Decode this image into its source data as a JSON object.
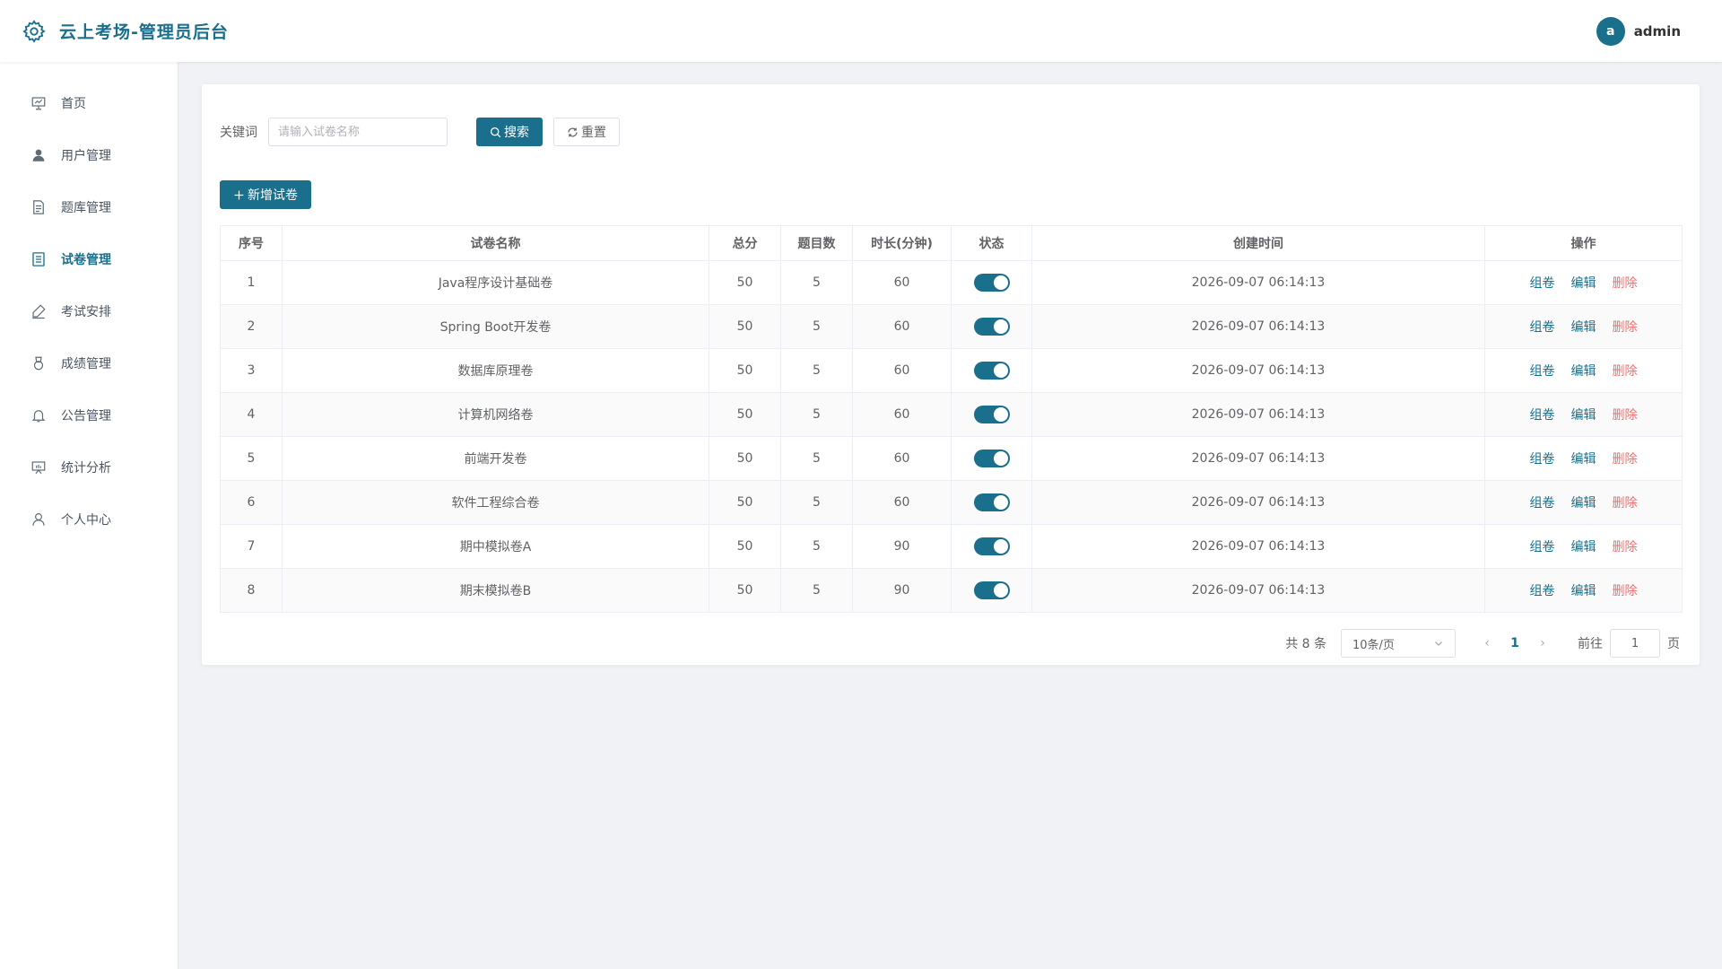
{
  "header": {
    "title": "云上考场-管理员后台",
    "avatar_letter": "a",
    "username": "admin"
  },
  "sidebar": {
    "items": [
      {
        "label": "首页",
        "icon": "presentation-icon"
      },
      {
        "label": "用户管理",
        "icon": "user-icon"
      },
      {
        "label": "题库管理",
        "icon": "document-icon"
      },
      {
        "label": "试卷管理",
        "icon": "tickets-icon",
        "active": true
      },
      {
        "label": "考试安排",
        "icon": "edit-pen-icon"
      },
      {
        "label": "成绩管理",
        "icon": "medal-icon"
      },
      {
        "label": "公告管理",
        "icon": "bell-icon"
      },
      {
        "label": "统计分析",
        "icon": "data-board-icon"
      },
      {
        "label": "个人中心",
        "icon": "user-outline-icon"
      }
    ]
  },
  "search": {
    "label": "关键词",
    "placeholder": "请输入试卷名称",
    "value": "",
    "search_label": "搜索",
    "reset_label": "重置"
  },
  "actions": {
    "add_label": "新增试卷"
  },
  "table": {
    "columns": [
      "序号",
      "试卷名称",
      "总分",
      "题目数",
      "时长(分钟)",
      "状态",
      "创建时间",
      "操作"
    ],
    "op_labels": {
      "compose": "组卷",
      "edit": "编辑",
      "delete": "删除"
    },
    "rows": [
      {
        "index": "1",
        "name": "Java程序设计基础卷",
        "score": "50",
        "count": "5",
        "duration": "60",
        "enabled": true,
        "created": "2026-09-07 06:14:13"
      },
      {
        "index": "2",
        "name": "Spring Boot开发卷",
        "score": "50",
        "count": "5",
        "duration": "60",
        "enabled": true,
        "created": "2026-09-07 06:14:13"
      },
      {
        "index": "3",
        "name": "数据库原理卷",
        "score": "50",
        "count": "5",
        "duration": "60",
        "enabled": true,
        "created": "2026-09-07 06:14:13"
      },
      {
        "index": "4",
        "name": "计算机网络卷",
        "score": "50",
        "count": "5",
        "duration": "60",
        "enabled": true,
        "created": "2026-09-07 06:14:13"
      },
      {
        "index": "5",
        "name": "前端开发卷",
        "score": "50",
        "count": "5",
        "duration": "60",
        "enabled": true,
        "created": "2026-09-07 06:14:13"
      },
      {
        "index": "6",
        "name": "软件工程综合卷",
        "score": "50",
        "count": "5",
        "duration": "60",
        "enabled": true,
        "created": "2026-09-07 06:14:13"
      },
      {
        "index": "7",
        "name": "期中模拟卷A",
        "score": "50",
        "count": "5",
        "duration": "90",
        "enabled": true,
        "created": "2026-09-07 06:14:13"
      },
      {
        "index": "8",
        "name": "期末模拟卷B",
        "score": "50",
        "count": "5",
        "duration": "90",
        "enabled": true,
        "created": "2026-09-07 06:14:13"
      }
    ]
  },
  "pagination": {
    "total_label": "共 8 条",
    "page_size": "10条/页",
    "current_page": "1",
    "goto_label": "前往",
    "goto_value": "1",
    "goto_suffix": "页"
  },
  "colors": {
    "accent": "#1a6f8c",
    "danger": "#f56c6c",
    "background": "#f0f2f5"
  }
}
